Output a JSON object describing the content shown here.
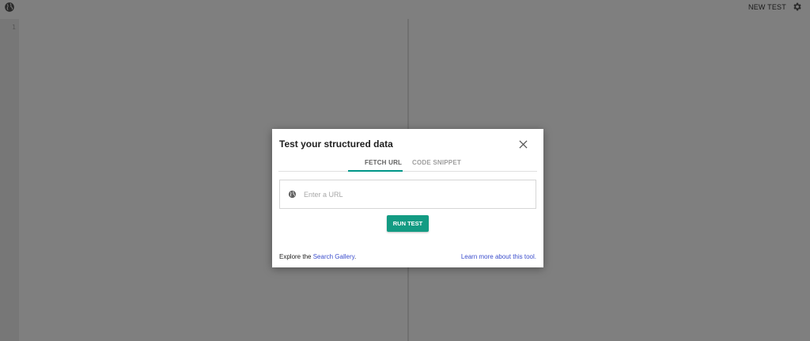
{
  "topbar": {
    "logo_icon": "globe-icon",
    "new_test_label": "NEW TEST",
    "settings_icon": "gear-icon"
  },
  "editor": {
    "line_numbers": [
      "1"
    ]
  },
  "dialog": {
    "title": "Test your structured data",
    "close_icon": "close-icon",
    "tabs": [
      {
        "label": "FETCH URL",
        "active": true
      },
      {
        "label": "CODE SNIPPET",
        "active": false
      }
    ],
    "url_input": {
      "placeholder": "Enter a URL",
      "value": ""
    },
    "run_button_label": "RUN TEST",
    "footer": {
      "explore_prefix": "Explore the ",
      "gallery_link": "Search Gallery",
      "explore_suffix": ".",
      "learn_more_link": "Learn more about this tool."
    }
  },
  "colors": {
    "accent": "#009688",
    "button": "#139b83",
    "link": "#3b4dcc",
    "overlay": "rgba(0,0,0,0.5)"
  }
}
